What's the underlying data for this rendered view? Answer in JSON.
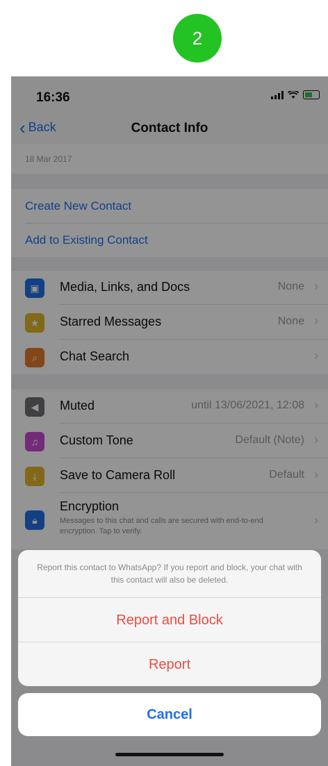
{
  "step_badge": "2",
  "status_bar": {
    "time": "16:36"
  },
  "nav": {
    "back_label": "Back",
    "title": "Contact Info"
  },
  "availability": {
    "date": "18 Mar 2017"
  },
  "contact_actions": {
    "create_new": "Create New Contact",
    "add_existing": "Add to Existing Contact"
  },
  "info_rows": [
    {
      "label": "Media, Links, and Docs",
      "value": "None",
      "icon": "image-icon",
      "color": "#1f6fe0"
    },
    {
      "label": "Starred Messages",
      "value": "None",
      "icon": "star-icon",
      "color": "#e0b62a"
    },
    {
      "label": "Chat Search",
      "value": "",
      "icon": "magnifier-icon",
      "color": "#e07b2a"
    }
  ],
  "settings_rows": [
    {
      "label": "Muted",
      "value": "until 13/06/2021, 12:08",
      "icon": "speaker-mute-icon",
      "color": "#6e6e73"
    },
    {
      "label": "Custom Tone",
      "value": "Default (Note)",
      "icon": "music-note-icon",
      "color": "#c54bd1"
    },
    {
      "label": "Save to Camera Roll",
      "value": "Default",
      "icon": "download-icon",
      "color": "#e0b62a"
    }
  ],
  "encryption": {
    "label": "Encryption",
    "subtitle": "Messages to this chat and calls are secured with end-to-end encryption. Tap to verify.",
    "icon": "lock-icon",
    "color": "#1f6fe0"
  },
  "action_sheet": {
    "message": "Report this contact to WhatsApp? If you report and block, your chat with this contact will also be deleted.",
    "report_block": "Report and Block",
    "report": "Report",
    "cancel": "Cancel"
  }
}
